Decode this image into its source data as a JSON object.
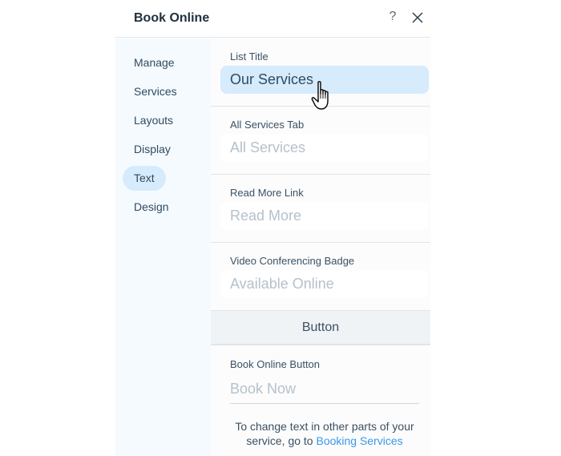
{
  "header": {
    "title": "Book Online",
    "help_label": "?",
    "help_icon": "question-mark-icon",
    "close_icon": "close-icon"
  },
  "sidebar": {
    "items": [
      {
        "label": "Manage",
        "active": false
      },
      {
        "label": "Services",
        "active": false
      },
      {
        "label": "Layouts",
        "active": false
      },
      {
        "label": "Display",
        "active": false
      },
      {
        "label": "Text",
        "active": true
      },
      {
        "label": "Design",
        "active": false
      }
    ]
  },
  "fields": [
    {
      "label": "List Title",
      "value": "Our Services",
      "active": true
    },
    {
      "label": "All Services Tab",
      "value": "All Services",
      "active": false
    },
    {
      "label": "Read More Link",
      "value": "Read More",
      "active": false
    },
    {
      "label": "Video Conferencing Badge",
      "value": "Available Online",
      "active": false
    }
  ],
  "button_section": {
    "title": "Button",
    "field_label": "Book Online Button",
    "field_value": "Book Now"
  },
  "footer": {
    "text": "To change text in other parts of your service, go to ",
    "link": "Booking Services"
  },
  "colors": {
    "accent": "#3899ec",
    "active_bg": "#d6ebfc",
    "sidebar_bg": "#f5faff"
  },
  "cursor": "hand-pointer-icon"
}
